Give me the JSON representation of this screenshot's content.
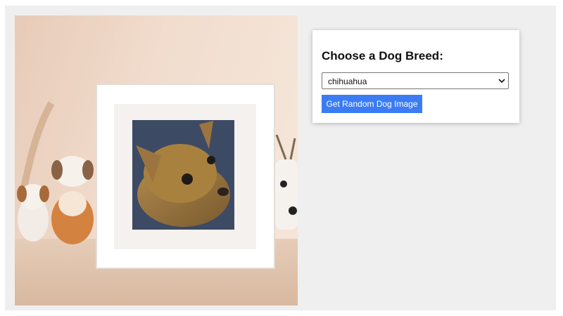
{
  "panel": {
    "heading": "Choose a Dog Breed:",
    "breed_select": {
      "selected": "chihuahua"
    },
    "button_label": "Get Random Dog Image",
    "button_color": "#3b7cf5"
  },
  "image": {
    "subject": "chihuahua-photo-in-frame",
    "icon": "framed-dog-photo"
  }
}
